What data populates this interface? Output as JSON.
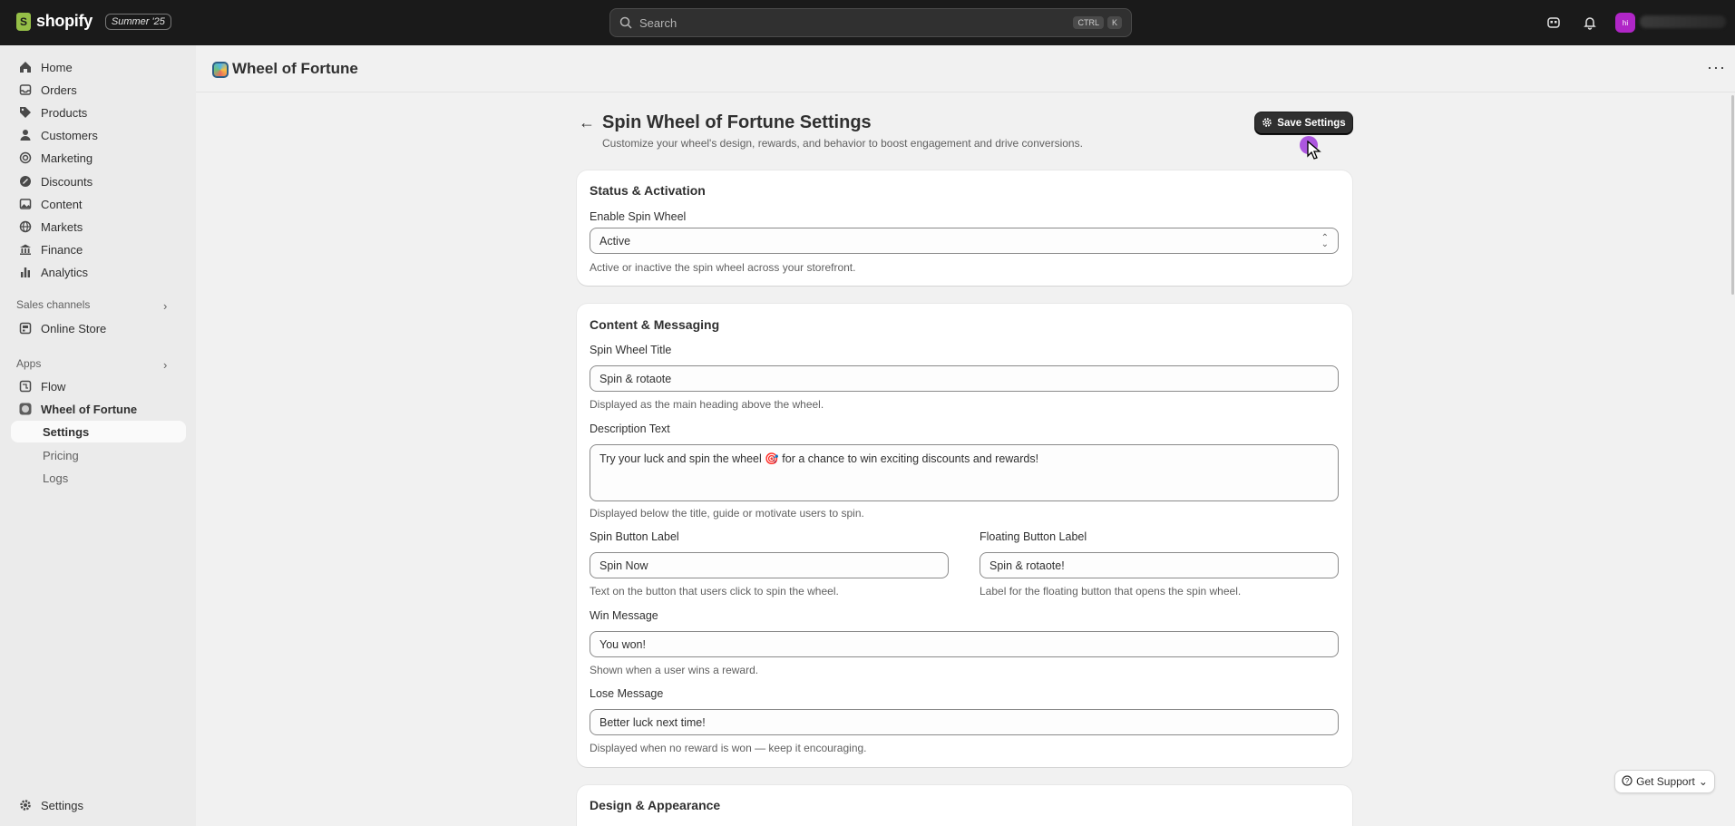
{
  "topbar": {
    "brand": "shopify",
    "season_badge": "Summer '25",
    "search_placeholder": "Search",
    "shortcut_key1": "CTRL",
    "shortcut_key2": "K",
    "avatar_initials": "hi"
  },
  "sidebar": {
    "items": [
      {
        "label": "Home",
        "icon": "home-icon"
      },
      {
        "label": "Orders",
        "icon": "inbox-icon"
      },
      {
        "label": "Products",
        "icon": "tag-icon"
      },
      {
        "label": "Customers",
        "icon": "person-icon"
      },
      {
        "label": "Marketing",
        "icon": "target-icon"
      },
      {
        "label": "Discounts",
        "icon": "discount-icon"
      },
      {
        "label": "Content",
        "icon": "image-icon"
      },
      {
        "label": "Markets",
        "icon": "globe-icon"
      },
      {
        "label": "Finance",
        "icon": "bank-icon"
      },
      {
        "label": "Analytics",
        "icon": "bar-chart-icon"
      }
    ],
    "sales_channels_label": "Sales channels",
    "online_store": "Online Store",
    "apps_label": "Apps",
    "flow": "Flow",
    "wheel_app": "Wheel of Fortune",
    "sub_settings": "Settings",
    "sub_pricing": "Pricing",
    "sub_logs": "Logs",
    "bottom_settings": "Settings"
  },
  "app_header": {
    "title": "Wheel of Fortune"
  },
  "page": {
    "title": "Spin Wheel of Fortune Settings",
    "subtitle": "Customize your wheel's design, rewards, and behavior to boost engagement and drive conversions.",
    "save_label": "Save Settings"
  },
  "status_card": {
    "title": "Status & Activation",
    "enable_label": "Enable Spin Wheel",
    "enable_value": "Active",
    "enable_help": "Active or inactive the spin wheel across your storefront."
  },
  "content_card": {
    "title": "Content & Messaging",
    "title_label": "Spin Wheel Title",
    "title_value": "Spin & rotaote",
    "title_help": "Displayed as the main heading above the wheel.",
    "desc_label": "Description Text",
    "desc_value": "Try your luck and spin the wheel 🎯 for a chance to win exciting discounts and rewards!",
    "desc_help": "Displayed below the title, guide or motivate users to spin.",
    "spin_btn_label": "Spin Button Label",
    "spin_btn_value": "Spin Now",
    "spin_btn_help": "Text on the button that users click to spin the wheel.",
    "float_btn_label": "Floating Button Label",
    "float_btn_value": "Spin & rotaote!",
    "float_btn_help": "Label for the floating button that opens the spin wheel.",
    "win_label": "Win Message",
    "win_value": "You won!",
    "win_help": "Shown when a user wins a reward.",
    "lose_label": "Lose Message",
    "lose_value": "Better luck next time!",
    "lose_help": "Displayed when no reward is won — keep it encouraging."
  },
  "design_card": {
    "title": "Design & Appearance"
  },
  "support": {
    "label": "Get Support"
  }
}
